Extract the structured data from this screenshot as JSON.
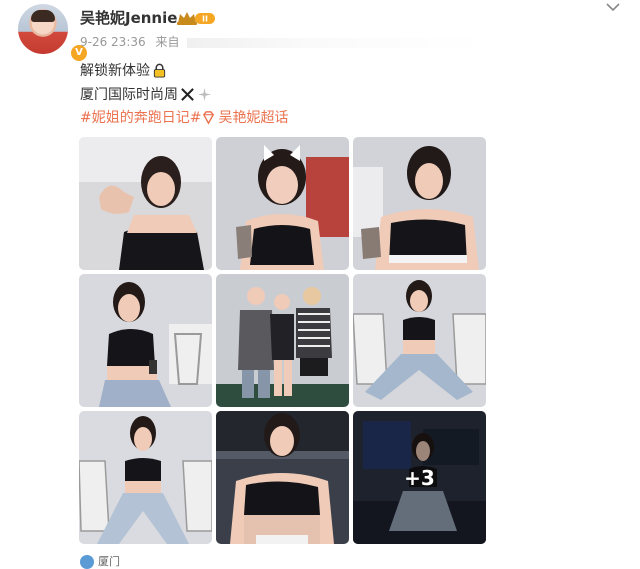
{
  "post": {
    "author": {
      "name": "吴艳妮Jennie",
      "verified_icon": "verified-v-badge",
      "vip_badge_icon": "crown-vip-badge",
      "vip_level": "II"
    },
    "meta": {
      "timestamp": "9-26 23:36",
      "source_prefix": "来自"
    },
    "text": {
      "line1": "解锁新体验",
      "line1_emoji": "lock-icon",
      "line2": "厦门国际时尚周",
      "line2_emoji": "crossed-swords-icon",
      "hashtag1": "#妮姐的奔跑日记#",
      "hashtag2": "吴艳妮超话",
      "hashtag2_icon": "diamond-supertopic-icon"
    },
    "photos": [
      {
        "alt": "selfie-flexing-arm"
      },
      {
        "alt": "selfie-hair-bow"
      },
      {
        "alt": "selfie-side-profile"
      },
      {
        "alt": "sitting-phone-in-hand"
      },
      {
        "alt": "group-photo-three-people"
      },
      {
        "alt": "sitting-on-chair-legs-wide"
      },
      {
        "alt": "sitting-on-folding-chair"
      },
      {
        "alt": "crop-top-portrait"
      },
      {
        "alt": "sitting-on-equipment-case"
      }
    ],
    "more_count": "+3",
    "location_label": "厦门"
  },
  "colors": {
    "hashtag": "#eb7350",
    "meta_gray": "#999999",
    "vip_gold": "#f5a623"
  }
}
